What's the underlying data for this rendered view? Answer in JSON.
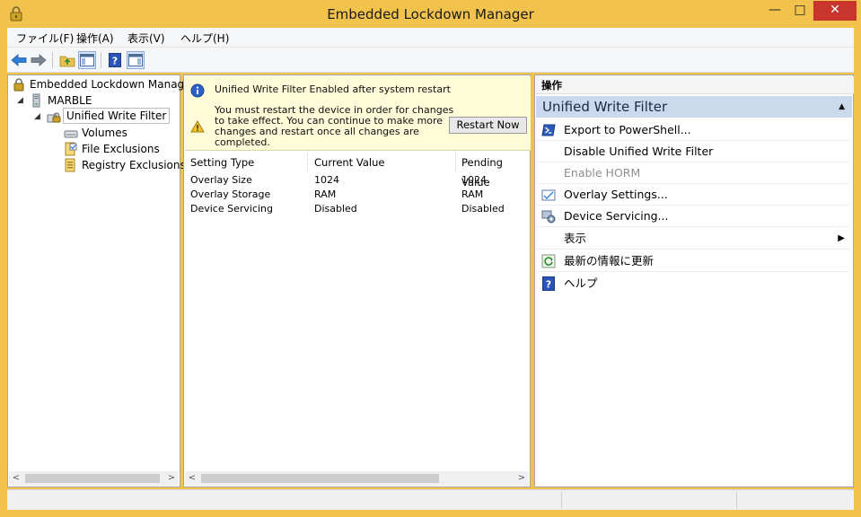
{
  "window": {
    "title": "Embedded Lockdown Manager",
    "accent_color": "#f1c24c",
    "controls": {
      "minimize": "—",
      "maximize": "□",
      "close": "✕"
    }
  },
  "menu": {
    "items": [
      "ファイル(F)",
      "操作(A)",
      "表示(V)",
      "ヘルプ(H)"
    ]
  },
  "toolbar": {
    "buttons": [
      "back-arrow-icon",
      "forward-arrow-icon",
      "folder-up-icon",
      "show-hide-tree-icon",
      "help-icon",
      "show-hide-action-pane-icon"
    ]
  },
  "tree": {
    "root": "Embedded Lockdown Manag",
    "device": "MARBLE",
    "feature": "Unified Write Filter",
    "children": [
      "Volumes",
      "File Exclusions",
      "Registry Exclusions"
    ]
  },
  "notice": {
    "info": "Unified Write Filter Enabled after system restart",
    "warning_lines": [
      "You must restart the device in order for changes",
      "to take effect. You can continue to make more",
      "changes and restart once all changes are",
      "completed."
    ],
    "restart_button": "Restart Now"
  },
  "settings_table": {
    "columns": [
      "Setting Type",
      "Current Value",
      "Pending Value"
    ],
    "rows": [
      [
        "Overlay Size",
        "1024",
        "1024"
      ],
      [
        "Overlay Storage",
        "RAM",
        "RAM"
      ],
      [
        "Device Servicing",
        "Disabled",
        "Disabled"
      ]
    ]
  },
  "actions": {
    "header": "操作",
    "section": "Unified Write Filter",
    "items": [
      {
        "label": "Export to PowerShell...",
        "icon": "powershell-icon",
        "enabled": true
      },
      {
        "label": "Disable Unified Write Filter",
        "icon": "",
        "enabled": true
      },
      {
        "label": "Enable HORM",
        "icon": "",
        "enabled": false
      },
      {
        "label": "Overlay Settings...",
        "icon": "overlay-settings-icon",
        "enabled": true
      },
      {
        "label": "Device Servicing...",
        "icon": "device-servicing-icon",
        "enabled": true
      },
      {
        "label": "表示",
        "icon": "",
        "enabled": true,
        "submenu": true
      },
      {
        "label": "最新の情報に更新",
        "icon": "refresh-icon",
        "enabled": true
      },
      {
        "label": "ヘルプ",
        "icon": "help-icon",
        "enabled": true
      }
    ]
  }
}
